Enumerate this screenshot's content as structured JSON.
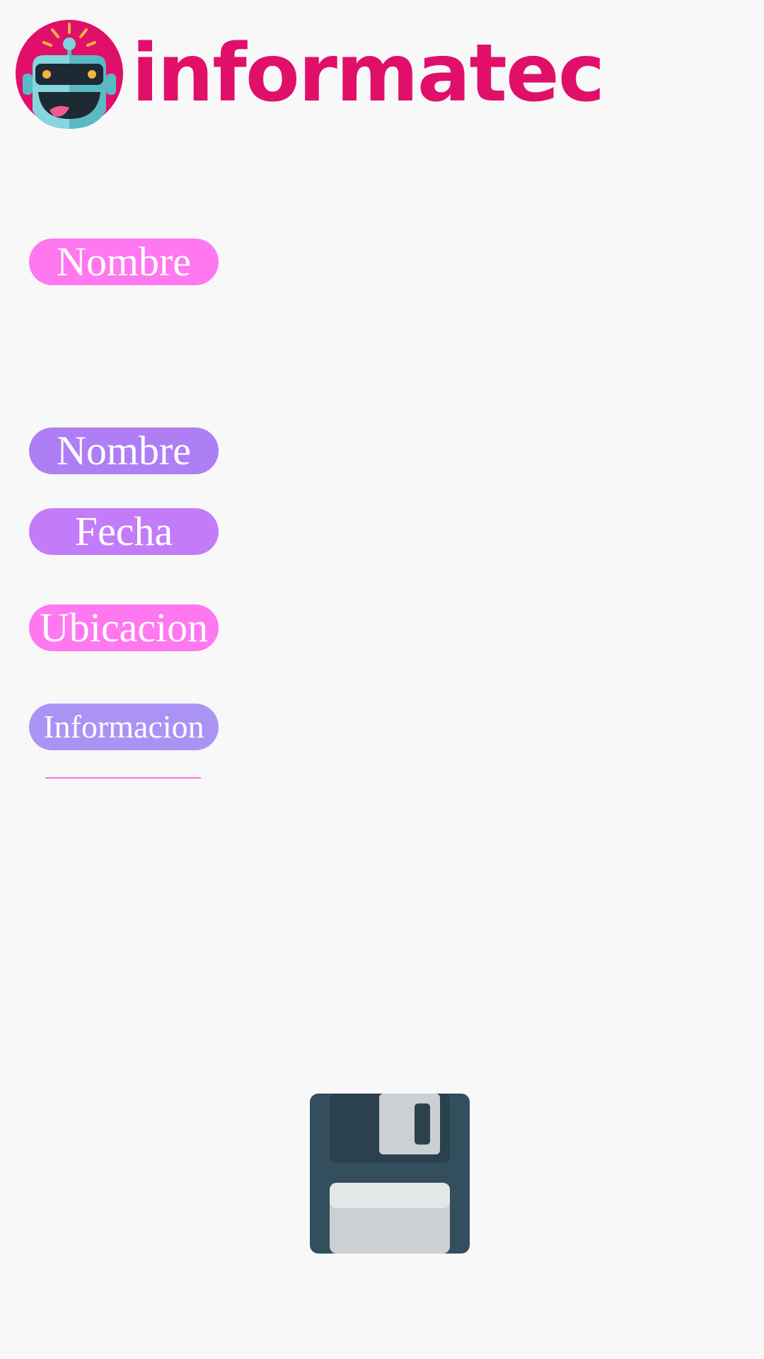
{
  "header": {
    "brand": "informatec",
    "logo_icon": "robot-icon"
  },
  "labels": {
    "nombre_top": "Nombre",
    "nombre": "Nombre",
    "fecha": "Fecha",
    "ubicacion": "Ubicacion",
    "informacion": "Informacion"
  },
  "colors": {
    "brand": "#e0106a",
    "pink_pill": "#ff78f0",
    "purple_pill": "#ae7ef5",
    "violet_pill": "#c37cf9",
    "lavender_pill": "#ab93f5",
    "save_icon_body": "#334e5c"
  },
  "actions": {
    "save_icon": "floppy-disk-icon"
  }
}
